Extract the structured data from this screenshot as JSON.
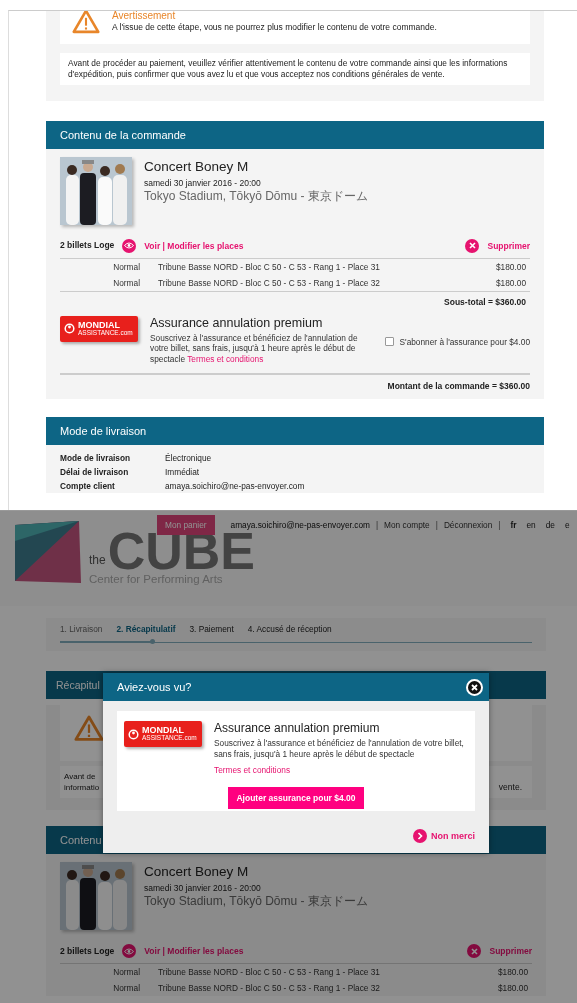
{
  "summary_page": {
    "warning": {
      "title": "Avertissement",
      "message": "A l'issue de cette étape, vous ne pourrez plus modifier le contenu de votre commande."
    },
    "notice": "Avant de procéder au paiement, veuillez vérifier attentivement le contenu de votre commande ainsi que les informations d'expédition, puis confirmer que vous avez lu et que vous acceptez nos conditions générales de vente.",
    "order": {
      "title": "Contenu de la commande",
      "event": {
        "title": "Concert Boney M",
        "date": "samedi 30 janvier 2016 - 20:00",
        "venue": "Tokyo Stadium, Tōkyō Dōmu - 東京ドーム"
      },
      "tickets": {
        "label": "2 billets Loge",
        "edit_link": "Voir | Modifier les places",
        "delete_link": "Supprimer"
      },
      "lines": [
        {
          "rate": "Normal",
          "seat": "Tribune Basse NORD - Bloc C 50 - C 53 - Rang 1 - Place 31",
          "price": "$180.00"
        },
        {
          "rate": "Normal",
          "seat": "Tribune Basse NORD - Bloc C 50 - C 53 - Rang 1 - Place 32",
          "price": "$180.00"
        }
      ],
      "subtotal": "Sous-total = $360.00",
      "insurance": {
        "logo_name": "MONDIAL",
        "logo_sub": "ASSISTANCE.com",
        "title": "Assurance annulation premium",
        "description": "Souscrivez à l'assurance et bénéficiez de l'annulation de votre billet, sans frais, jusqu'à 1 heure après le début de spectacle",
        "terms_link": "Termes et conditions",
        "checkbox_label": "S'abonner à l'assurance pour $4.00",
        "checked": false
      },
      "total": "Montant de la commande = $360.00"
    },
    "delivery": {
      "title": "Mode de livraison",
      "rows": [
        {
          "label": "Mode de livraison",
          "value": "Électronique"
        },
        {
          "label": "Délai de livraison",
          "value": "Immédiat"
        },
        {
          "label": "Compte client",
          "value": "amaya.soichiro@ne-pas-envoyer.com"
        }
      ]
    }
  },
  "dimmed_page": {
    "logo": {
      "prefix": "the",
      "word": "CUBE",
      "tagline": "Center for Performing Arts"
    },
    "cart_button": "Mon panier",
    "account_bar": [
      {
        "kind": "text",
        "text": "amaya.soichiro@ne-pas-envoyer.com"
      },
      {
        "kind": "separator",
        "text": "|"
      },
      {
        "kind": "link",
        "text": "Mon compte"
      },
      {
        "kind": "separator",
        "text": "|"
      },
      {
        "kind": "link",
        "text": "Déconnexion"
      },
      {
        "kind": "separator",
        "text": "|"
      }
    ],
    "languages": [
      {
        "label": "fr",
        "selected": true
      },
      {
        "label": "en",
        "selected": false
      },
      {
        "label": "de",
        "selected": false
      },
      {
        "label": "e",
        "selected": false
      }
    ],
    "steps": [
      {
        "label": "1. Livraison",
        "selected": false
      },
      {
        "label": "2. Récapitulatif",
        "selected": true
      },
      {
        "label": "3. Paiement",
        "selected": false
      },
      {
        "label": "4. Accusé de réception",
        "selected": false
      }
    ],
    "recap_title": "Récapitul",
    "notice_start": [
      "Avant de",
      "informatio"
    ],
    "notice_end": "vente.",
    "order_title": "Contenu",
    "event": {
      "title": "Concert Boney M",
      "date": "samedi 30 janvier 2016 - 20:00",
      "venue": "Tokyo Stadium, Tōkyō Dōmu - 東京ドーム"
    },
    "tickets": {
      "label": "2 billets Loge",
      "edit_link": "Voir | Modifier les places",
      "delete_link": "Supprimer"
    },
    "lines": [
      {
        "rate": "Normal",
        "seat": "Tribune Basse NORD - Bloc C 50 - C 53 - Rang 1 - Place 31",
        "price": "$180.00"
      },
      {
        "rate": "Normal",
        "seat": "Tribune Basse NORD - Bloc C 50 - C 53 - Rang 1 - Place 32",
        "price": "$180.00"
      }
    ]
  },
  "modal": {
    "title": "Aviez-vous vu?",
    "logo_name": "MONDIAL",
    "logo_sub": "ASSISTANCE.com",
    "offer_title": "Assurance annulation premium",
    "description": "Souscrivez à l'assurance et bénéficiez de l'annulation de votre billet, sans frais, jusqu'à 1 heure après le début de spectacle",
    "terms_link": "Termes et conditions",
    "add_button": "Ajouter assurance pour $4.00",
    "decline_link": "Non merci"
  }
}
